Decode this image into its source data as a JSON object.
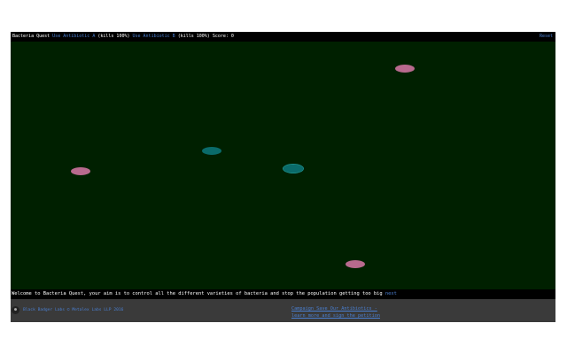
{
  "topbar": {
    "title": "Bacteria Quest",
    "antibiotic_a_link": "Use Antibiotic A",
    "antibiotic_a_info": "(kills 100%)",
    "antibiotic_b_link": "Use Antibiotic B",
    "antibiotic_b_info": "(kills 100%)",
    "score_label": "Score:",
    "score_value": "0",
    "reset_label": "Reset"
  },
  "bacteria": [
    {
      "kind": "pink"
    },
    {
      "kind": "teal"
    },
    {
      "kind": "pink"
    },
    {
      "kind": "teal"
    },
    {
      "kind": "pink"
    }
  ],
  "message": {
    "text": "Welcome to Bacteria Quest, your aim is to control all the different varieties of bacteria and stop the population getting too big",
    "next_label": "next"
  },
  "footer": {
    "credit": "Black Badger Labs © Metalex Labs LLP 2016",
    "campaign_line1": "Campaign Save Our Antibiotics -",
    "campaign_line2": "learn more and sign the petition"
  },
  "colors": {
    "field": "#002000",
    "pink_bacteria": "#b86a8e",
    "teal_bacteria": "#0a6b6a",
    "link": "#4a7fd0",
    "footer_bg": "#3a3a3a"
  }
}
